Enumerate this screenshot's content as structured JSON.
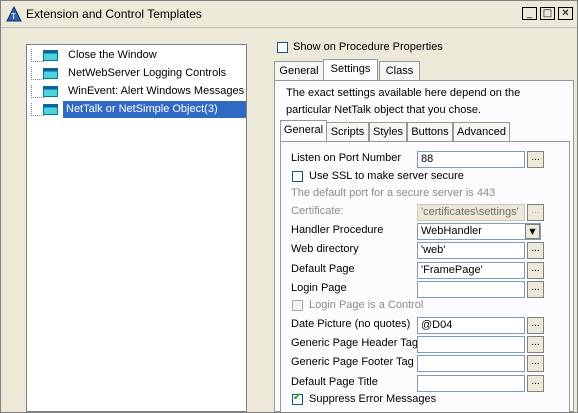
{
  "window": {
    "title": "Extension and Control Templates",
    "controls": {
      "minimize": "_",
      "maximize": "□",
      "close": "✕"
    }
  },
  "tree": {
    "items": [
      {
        "label": "Close the Window",
        "selected": false
      },
      {
        "label": "NetWebServer Logging Controls",
        "selected": false
      },
      {
        "label": "WinEvent: Alert Windows Messages",
        "selected": false
      },
      {
        "label": "NetTalk or NetSimple Object(3)",
        "selected": true
      }
    ]
  },
  "options": {
    "show_on_procedure_properties": "Show on Procedure Properties",
    "checked": false
  },
  "outer_tabs": [
    "General",
    "Settings",
    "Class"
  ],
  "outer_active": "Settings",
  "description": [
    "The exact settings available here depend on the",
    "particular NetTalk object that you chose."
  ],
  "inner_tabs": [
    "General",
    "Scripts",
    "Styles",
    "Buttons",
    "Advanced"
  ],
  "inner_active": "General",
  "ellipsis": "...",
  "dropdown_arrow": "▼",
  "form": {
    "listen_port": {
      "label": "Listen on Port Number",
      "value": "88"
    },
    "use_ssl": {
      "label": "Use SSL to make server secure",
      "checked": false
    },
    "ssl_note": "The default port for a secure server is 443",
    "certificate": {
      "label": "Certificate:",
      "value": "'certificates\\settings'"
    },
    "handler_procedure": {
      "label": "Handler Procedure",
      "value": "WebHandler"
    },
    "web_directory": {
      "label": "Web directory",
      "value": "'web'"
    },
    "default_page": {
      "label": "Default Page",
      "value": "'FramePage'"
    },
    "login_page": {
      "label": "Login Page",
      "value": ""
    },
    "login_page_is_control": {
      "label": "Login Page is a Control",
      "checked": false
    },
    "date_picture": {
      "label": "Date Picture (no quotes)",
      "value": "@D04"
    },
    "header_tag": {
      "label": "Generic Page Header Tag",
      "value": ""
    },
    "footer_tag": {
      "label": "Generic Page Footer Tag",
      "value": ""
    },
    "default_page_title": {
      "label": "Default Page Title",
      "value": ""
    },
    "suppress_errors": {
      "label": "Suppress Error Messages",
      "checked": true
    }
  }
}
